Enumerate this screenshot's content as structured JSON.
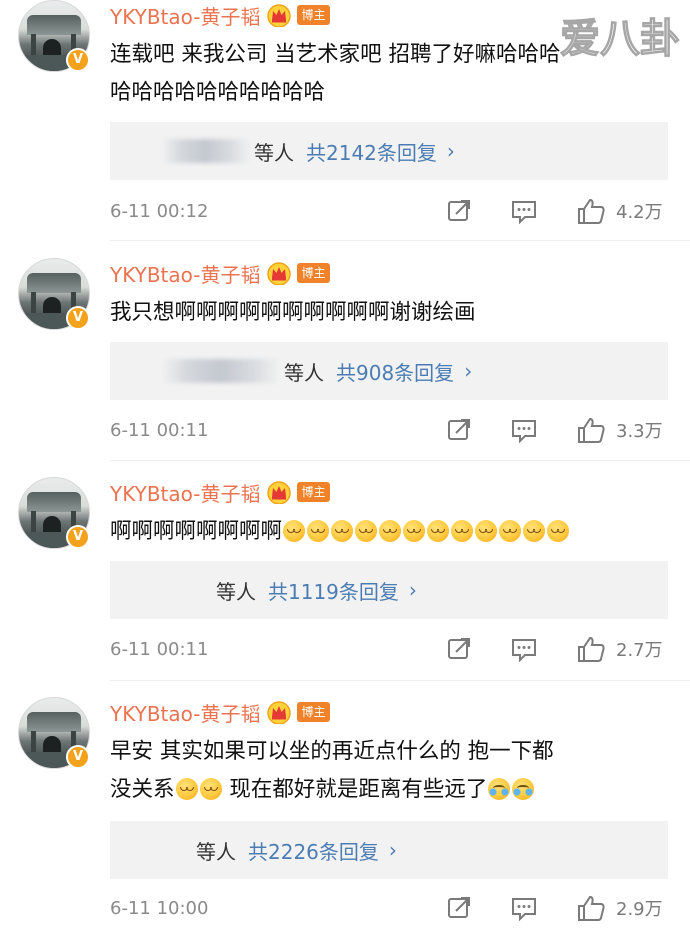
{
  "watermark": {
    "text": "爱八卦"
  },
  "comments": [
    {
      "username": "YKYBtao-黄子韬",
      "badge": "博主",
      "text_segments": [
        "连载吧 来我公司 当艺术家吧 招聘了好嘛哈哈哈",
        "哈哈哈哈哈哈哈哈哈哈"
      ],
      "reply_prefix": "等人",
      "reply_link": "共2142条回复",
      "time": "6-11 00:12",
      "likes": "4.2万"
    },
    {
      "username": "YKYBtao-黄子韬",
      "badge": "博主",
      "text_segments": [
        "我只想啊啊啊啊啊啊啊啊啊啊谢谢绘画"
      ],
      "reply_prefix": "等人",
      "reply_link": "共908条回复",
      "time": "6-11 00:11",
      "likes": "3.3万"
    },
    {
      "username": "YKYBtao-黄子韬",
      "badge": "博主",
      "text_segments": [
        "啊啊啊啊啊啊啊啊"
      ],
      "emoji_run": 12,
      "reply_prefix": "等人",
      "reply_link": "共1119条回复",
      "time": "6-11 00:11",
      "likes": "2.7万"
    },
    {
      "username": "YKYBtao-黄子韬",
      "badge": "博主",
      "text_segments": [
        "早安  其实如果可以坐的再近点什么的 抱一下都",
        "没关系",
        "  现在都好就是距离有些远了"
      ],
      "reply_prefix": "等人",
      "reply_link": "共2226条回复",
      "time": "6-11 10:00",
      "likes": "2.9万"
    }
  ],
  "icons": {
    "crown": "crown-icon",
    "share": "share-icon",
    "comment": "comment-icon",
    "like": "thumbs-up-icon",
    "verified": "verified-v-icon",
    "emoji_blush": "blush-emoji",
    "emoji_cry": "laugh-cry-emoji"
  },
  "colors": {
    "username": "#eb7350",
    "badge": "#f0822a",
    "link": "#4b7db4",
    "meta": "#8a8a8a",
    "reply_bg": "#f2f2f2",
    "watermark": "#a0a0a0"
  }
}
